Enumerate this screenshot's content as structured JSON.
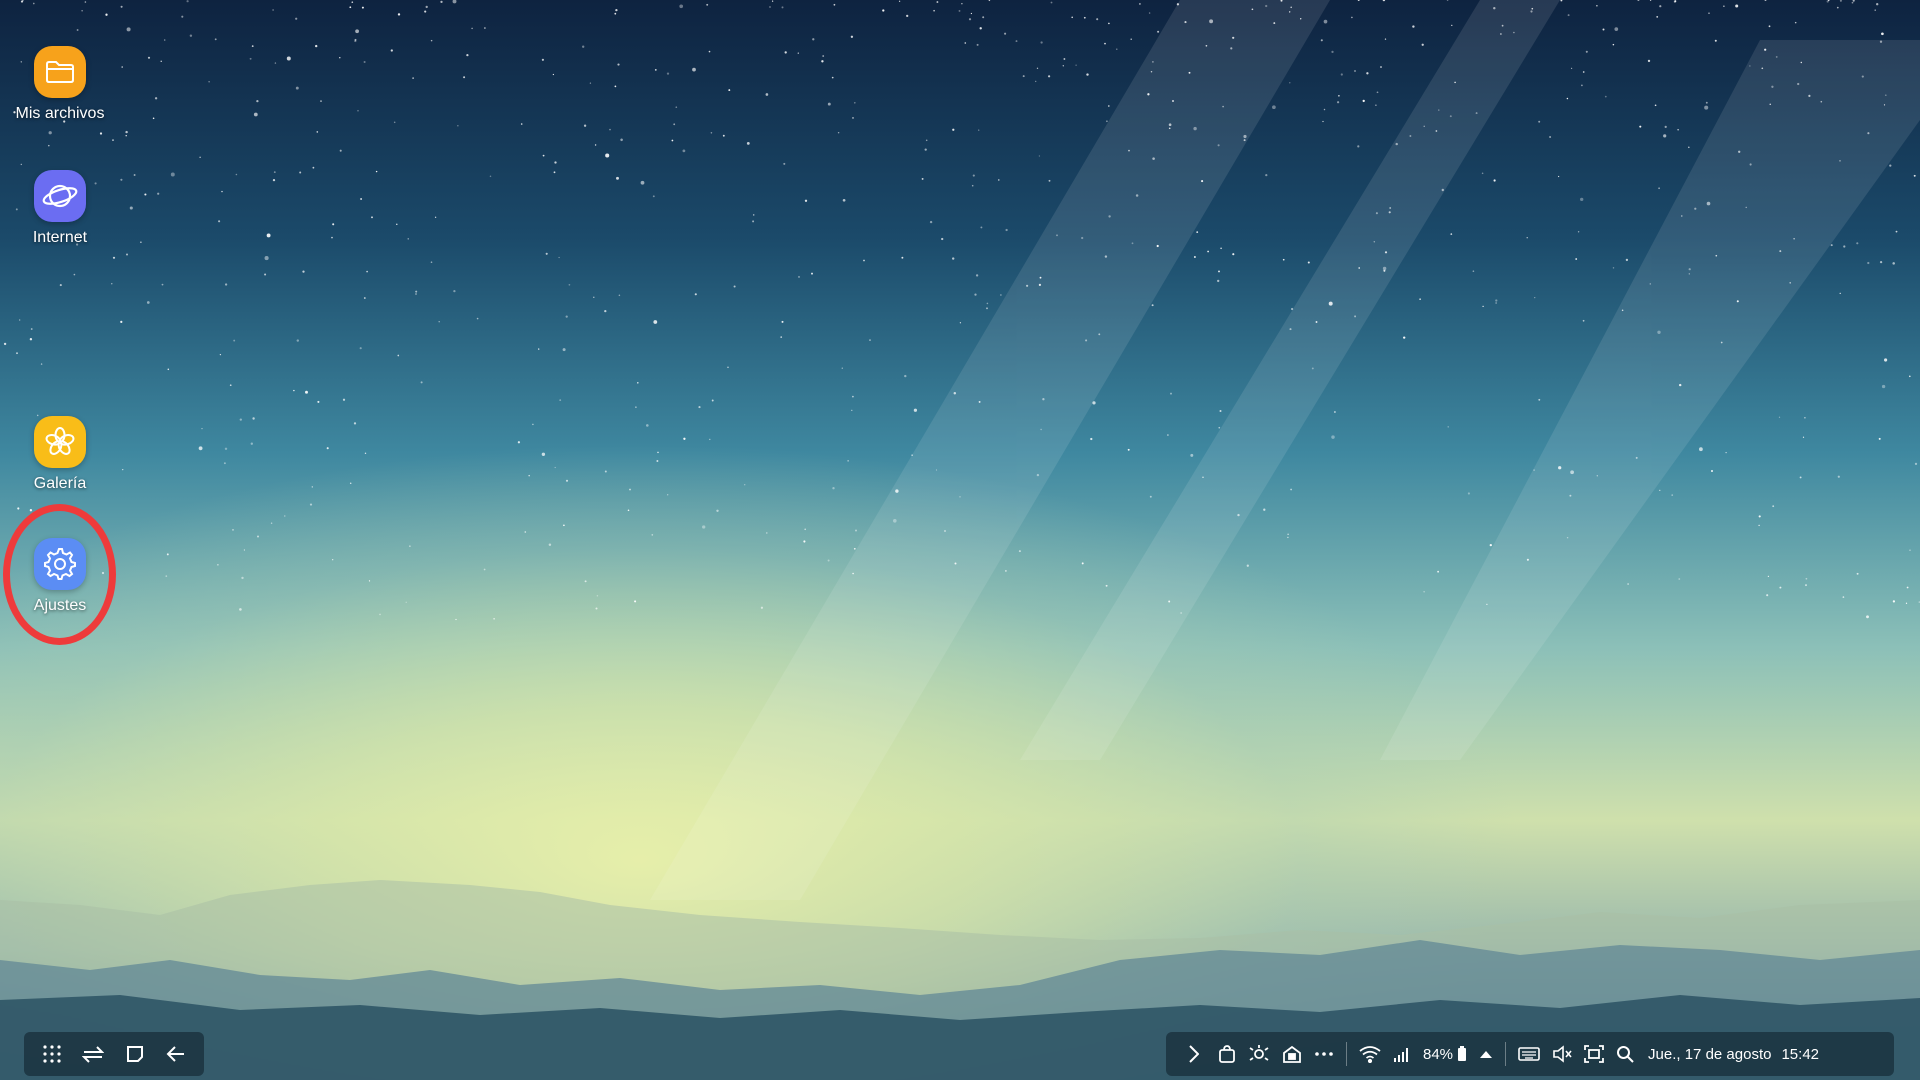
{
  "desktop": {
    "icons": [
      {
        "label": "Mis archivos",
        "icon": "folder-icon",
        "color": "#f7a21b"
      },
      {
        "label": "Internet",
        "icon": "planet-icon",
        "color": "#6b6df2"
      },
      {
        "label": "Galería",
        "icon": "flower-icon",
        "color": "#f9bd18"
      },
      {
        "label": "Ajustes",
        "icon": "gear-icon",
        "color": "#5b8df4"
      }
    ],
    "highlight_color": "#ee3b3b"
  },
  "taskbar": {
    "nav": {
      "apps_icon": "apps-grid-icon",
      "switch_icon": "switch-windows-icon",
      "recent_icon": "recent-apps-icon",
      "back_icon": "back-arrow-icon"
    },
    "tray": {
      "battery": "84%",
      "datetime": "Jue., 17 de agosto",
      "time": "15:42"
    }
  }
}
